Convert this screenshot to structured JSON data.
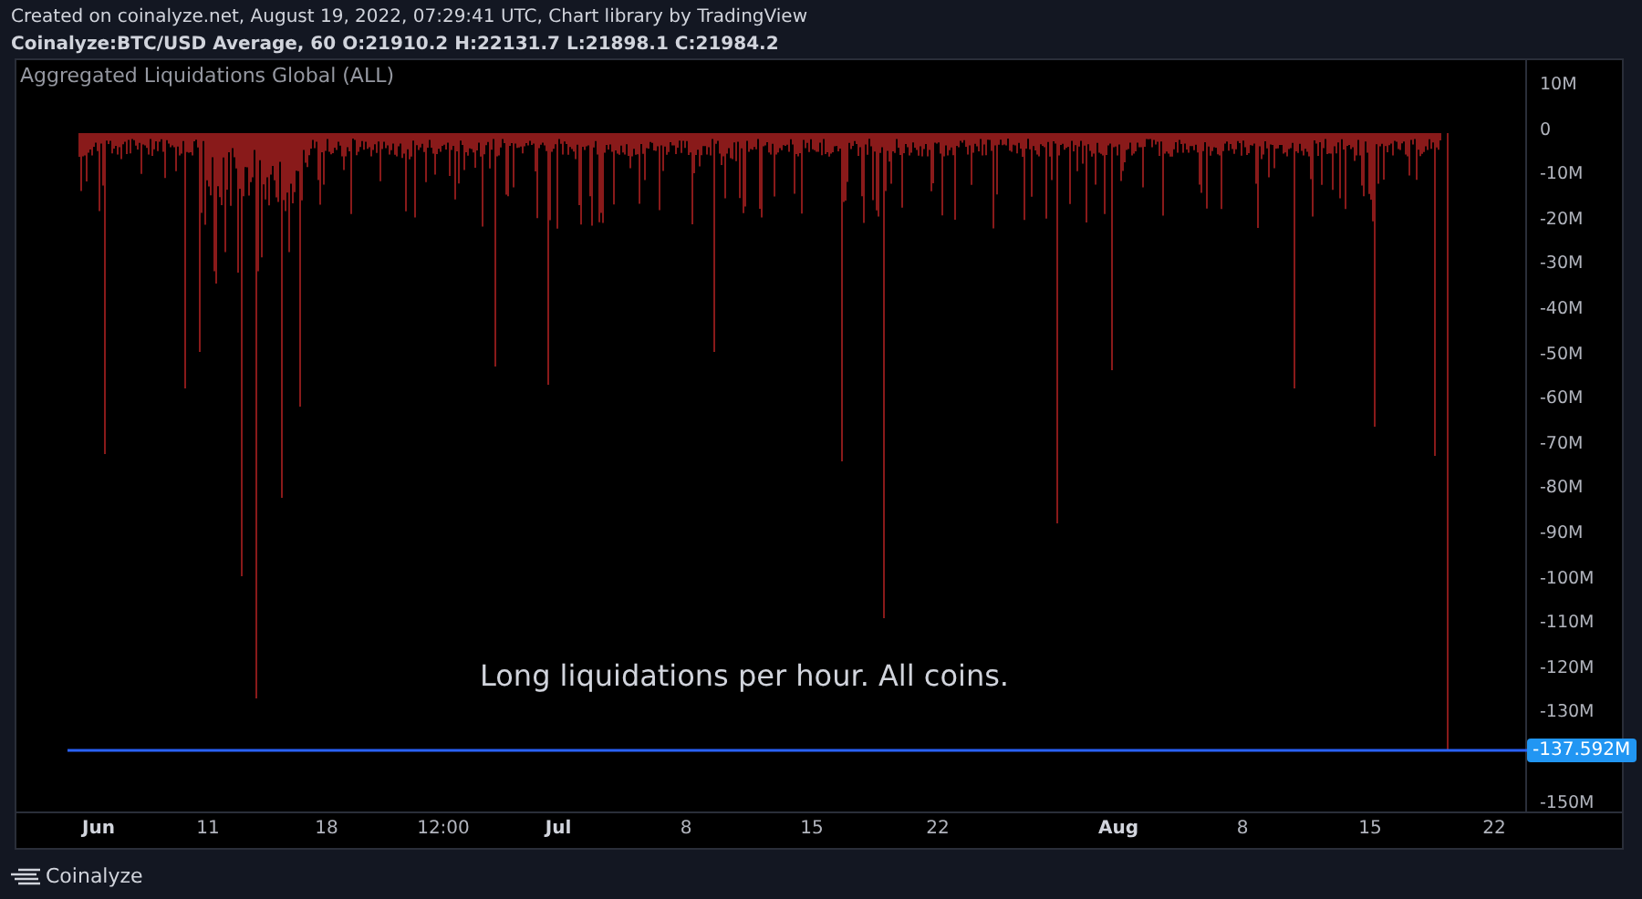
{
  "header": {
    "created": "Created on coinalyze.net, August 19, 2022, 07:29:41 UTC, Chart library by TradingView",
    "symbol": "Coinalyze:BTC/USD Average, 60 O:21910.2 H:22131.7 L:21898.1 C:21984.2"
  },
  "chart": {
    "legend": "Aggregated Liquidations Global (ALL)",
    "annotation": "Long liquidations per hour. All coins.",
    "last_value": "-137.592M",
    "y_ticks": [
      "10M",
      "0",
      "-10M",
      "-20M",
      "-30M",
      "-40M",
      "-50M",
      "-60M",
      "-70M",
      "-80M",
      "-90M",
      "-100M",
      "-110M",
      "-120M",
      "-130M"
    ],
    "y_bottom": "-150M",
    "x_ticks": [
      {
        "label": "Jun",
        "kind": "month"
      },
      {
        "label": "11",
        "kind": "day"
      },
      {
        "label": "18",
        "kind": "day"
      },
      {
        "label": "12:00",
        "kind": "day"
      },
      {
        "label": "Jul",
        "kind": "month"
      },
      {
        "label": "8",
        "kind": "day"
      },
      {
        "label": "15",
        "kind": "day"
      },
      {
        "label": "22",
        "kind": "day"
      },
      {
        "label": "Aug",
        "kind": "month"
      },
      {
        "label": "8",
        "kind": "day"
      },
      {
        "label": "15",
        "kind": "day"
      },
      {
        "label": "22",
        "kind": "day"
      }
    ]
  },
  "footer": {
    "brand": "Coinalyze"
  }
}
